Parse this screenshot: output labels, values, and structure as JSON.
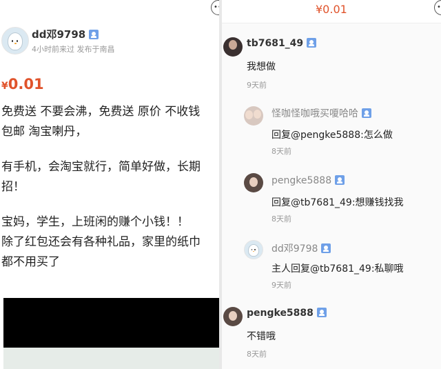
{
  "post": {
    "author": "dd邓9798",
    "meta": "4小时前来过 发布于南昌",
    "price_symbol": "¥",
    "price_value": "0.01",
    "body_lines": [
      "免费送 不要会沸，免费送  原价 不收钱",
      "包邮 淘宝喇丹，",
      "",
      "有手机，会淘宝就行，简单好做，长期",
      "招！",
      "",
      "宝妈，学生，上班闲的赚个小钱！！",
      "除了红包还会有各种礼品，家里的纸巾",
      "都不用买了"
    ]
  },
  "right_header": {
    "price": "¥0.01"
  },
  "comments": [
    {
      "name": "tb7681_49",
      "text": "我想做",
      "time": "9天前",
      "avatar": "dark"
    },
    {
      "name": "怪咖怪咖哦买嗄哈哈",
      "text": "回复@pengke5888:怎么做",
      "time": "8天前",
      "avatar": "girls"
    },
    {
      "name": "pengke5888",
      "text": "回复@tb7681_49:想赚钱找我",
      "time": "8天前",
      "avatar": "woman"
    },
    {
      "name": "dd邓9798",
      "text": "主人回复@tb7681_49:私聊哦",
      "time": "9天前",
      "avatar": "bird"
    },
    {
      "name": "pengke5888",
      "text": "不错哦",
      "time": "8天前",
      "avatar": "woman"
    }
  ],
  "icons": {
    "more": "more-dots-icon",
    "verified": "verified-badge-icon"
  },
  "colors": {
    "price": "#e0532b",
    "badge": "#6fa0e8"
  }
}
